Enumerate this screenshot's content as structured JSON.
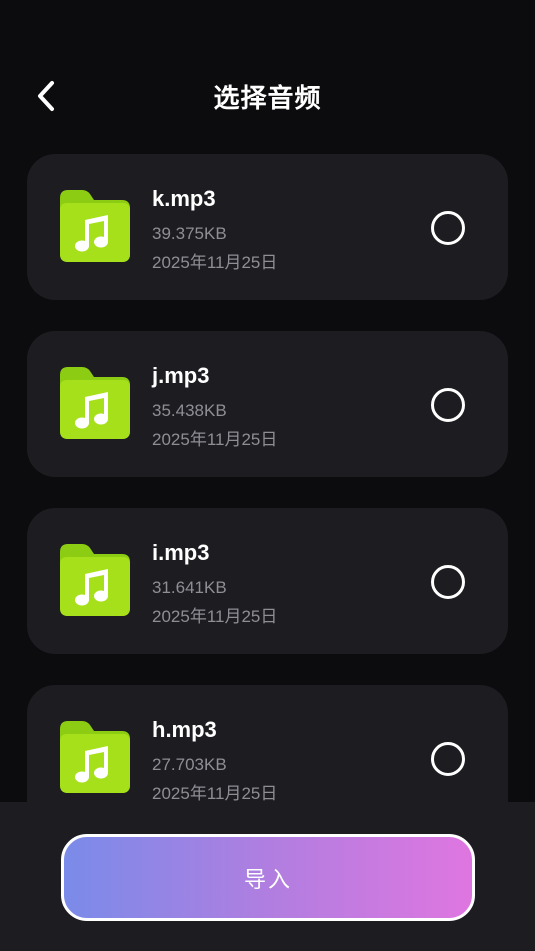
{
  "header": {
    "title": "选择音频",
    "back_icon": "chevron-left-icon"
  },
  "files": [
    {
      "name": "k.mp3",
      "size": "39.375KB",
      "date": "2025年11月25日",
      "selected": false
    },
    {
      "name": "j.mp3",
      "size": "35.438KB",
      "date": "2025年11月25日",
      "selected": false
    },
    {
      "name": "i.mp3",
      "size": "31.641KB",
      "date": "2025年11月25日",
      "selected": false
    },
    {
      "name": "h.mp3",
      "size": "27.703KB",
      "date": "2025年11月25日",
      "selected": false
    }
  ],
  "footer": {
    "import_label": "导入"
  },
  "colors": {
    "background": "#0c0c0e",
    "card": "#1c1c21",
    "icon_green": "#a6e01a",
    "secondary_text": "#8e8e95",
    "button_gradient_start": "#7a8be9",
    "button_gradient_end": "#df76e0"
  }
}
